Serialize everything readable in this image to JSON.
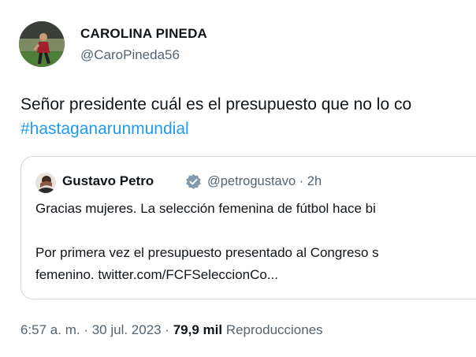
{
  "author": {
    "name": "CAROLINA PINEDA",
    "handle": "@CaroPineda56"
  },
  "tweet": {
    "text": "Señor presidente cuál es el presupuesto que no lo co",
    "hashtag": "#hastaganarunmundial"
  },
  "quoted_tweet": {
    "name": "Gustavo Petro",
    "handle_time": "@petrogustavo · 2h",
    "line1": "Gracias mujeres. La selección femenina de fútbol hace bi",
    "line2": "Por primera vez el presupuesto presentado al Congreso s",
    "line3": "femenino. twitter.com/FCFSeleccionCo..."
  },
  "meta": {
    "datetime": "6:57 a. m. · 30 jul. 2023 · ",
    "views_count": "79,9 mil",
    "views_label": " Reproducciones"
  },
  "colors": {
    "link": "#1d9bf0",
    "secondary_text": "#536471",
    "border": "#cfd9de",
    "verified_badge": "#829aab"
  }
}
